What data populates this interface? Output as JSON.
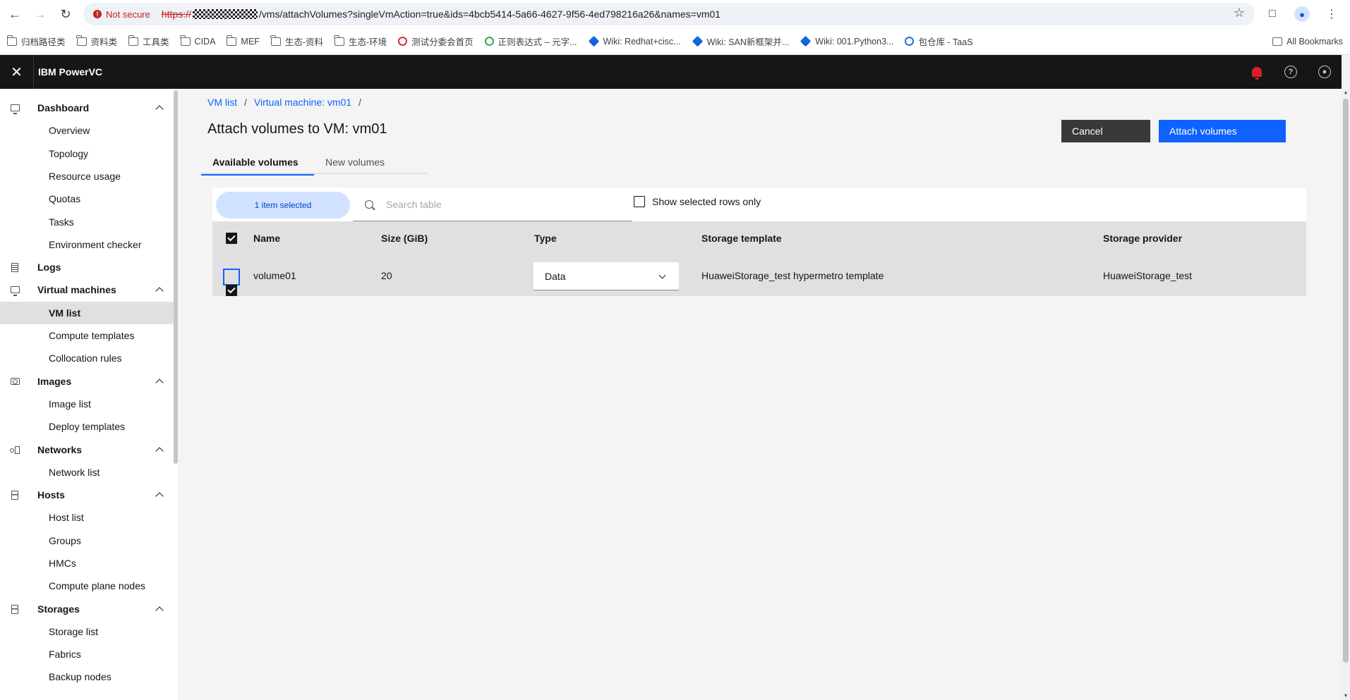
{
  "browser": {
    "security_label": "Not secure",
    "url_scheme": "https://",
    "url_rest": "/vms/attachVolumes?singleVmAction=true&ids=4bcb5414-5a66-4627-9f56-4ed798216a26&names=vm01",
    "bookmarks": [
      {
        "label": "归档路径类",
        "icon": "folder-icon"
      },
      {
        "label": "资料类",
        "icon": "folder-icon"
      },
      {
        "label": "工具类",
        "icon": "folder-icon"
      },
      {
        "label": "CIDA",
        "icon": "folder-icon"
      },
      {
        "label": "MEF",
        "icon": "folder-icon"
      },
      {
        "label": "生态-资料",
        "icon": "folder-icon"
      },
      {
        "label": "生态-环境",
        "icon": "folder-icon"
      },
      {
        "label": "测试分委会首页",
        "icon": "site-icon",
        "color": "#d93025"
      },
      {
        "label": "正则表达式 – 元字...",
        "icon": "site-icon",
        "color": "#34a853"
      },
      {
        "label": "Wiki: Redhat+cisc...",
        "icon": "diamond-icon"
      },
      {
        "label": "Wiki: SAN新框架并...",
        "icon": "diamond-icon"
      },
      {
        "label": "Wiki: 001.Python3...",
        "icon": "diamond-icon"
      },
      {
        "label": "包仓库 - TaaS",
        "icon": "site-icon",
        "color": "#1a73e8"
      }
    ],
    "all_bookmarks": "All Bookmarks"
  },
  "header": {
    "product_name": "IBM PowerVC"
  },
  "sidenav": {
    "categories": [
      {
        "label": "Dashboard",
        "icon": "monitor-icon",
        "items": [
          "Overview",
          "Topology",
          "Resource usage",
          "Quotas",
          "Tasks",
          "Environment checker"
        ]
      },
      {
        "label": "Logs",
        "icon": "document-icon",
        "items": []
      },
      {
        "label": "Virtual machines",
        "icon": "monitor-icon",
        "items": [
          "VM list",
          "Compute templates",
          "Collocation rules"
        ]
      },
      {
        "label": "Images",
        "icon": "camera-icon",
        "items": [
          "Image list",
          "Deploy templates"
        ]
      },
      {
        "label": "Networks",
        "icon": "network-icon",
        "items": [
          "Network list"
        ]
      },
      {
        "label": "Hosts",
        "icon": "server-icon",
        "items": [
          "Host list",
          "Groups",
          "HMCs",
          "Compute plane nodes"
        ]
      },
      {
        "label": "Storages",
        "icon": "server-icon",
        "items": [
          "Storage list",
          "Fabrics",
          "Backup nodes"
        ]
      }
    ],
    "active_item": "VM list"
  },
  "breadcrumb": {
    "items": [
      "VM list",
      "Virtual machine: vm01"
    ]
  },
  "page": {
    "title": "Attach volumes to VM: vm01",
    "cancel_label": "Cancel",
    "attach_label": "Attach volumes",
    "tabs": [
      {
        "label": "Available volumes",
        "active": true
      },
      {
        "label": "New volumes",
        "active": false
      }
    ]
  },
  "table": {
    "selected_summary": "1 item selected",
    "search_placeholder": "Search table",
    "show_selected_label": "Show selected rows only",
    "columns": [
      "Name",
      "Size (GiB)",
      "Type",
      "Storage template",
      "Storage provider"
    ],
    "rows": [
      {
        "name": "volume01",
        "size": "20",
        "type": "Data",
        "storage_template": "HuaweiStorage_test hypermetro template",
        "storage_provider": "HuaweiStorage_test",
        "selected": true
      }
    ]
  },
  "colors": {
    "primary": "#0f62fe",
    "header_bg": "#161616",
    "notification": "#da1e28"
  }
}
